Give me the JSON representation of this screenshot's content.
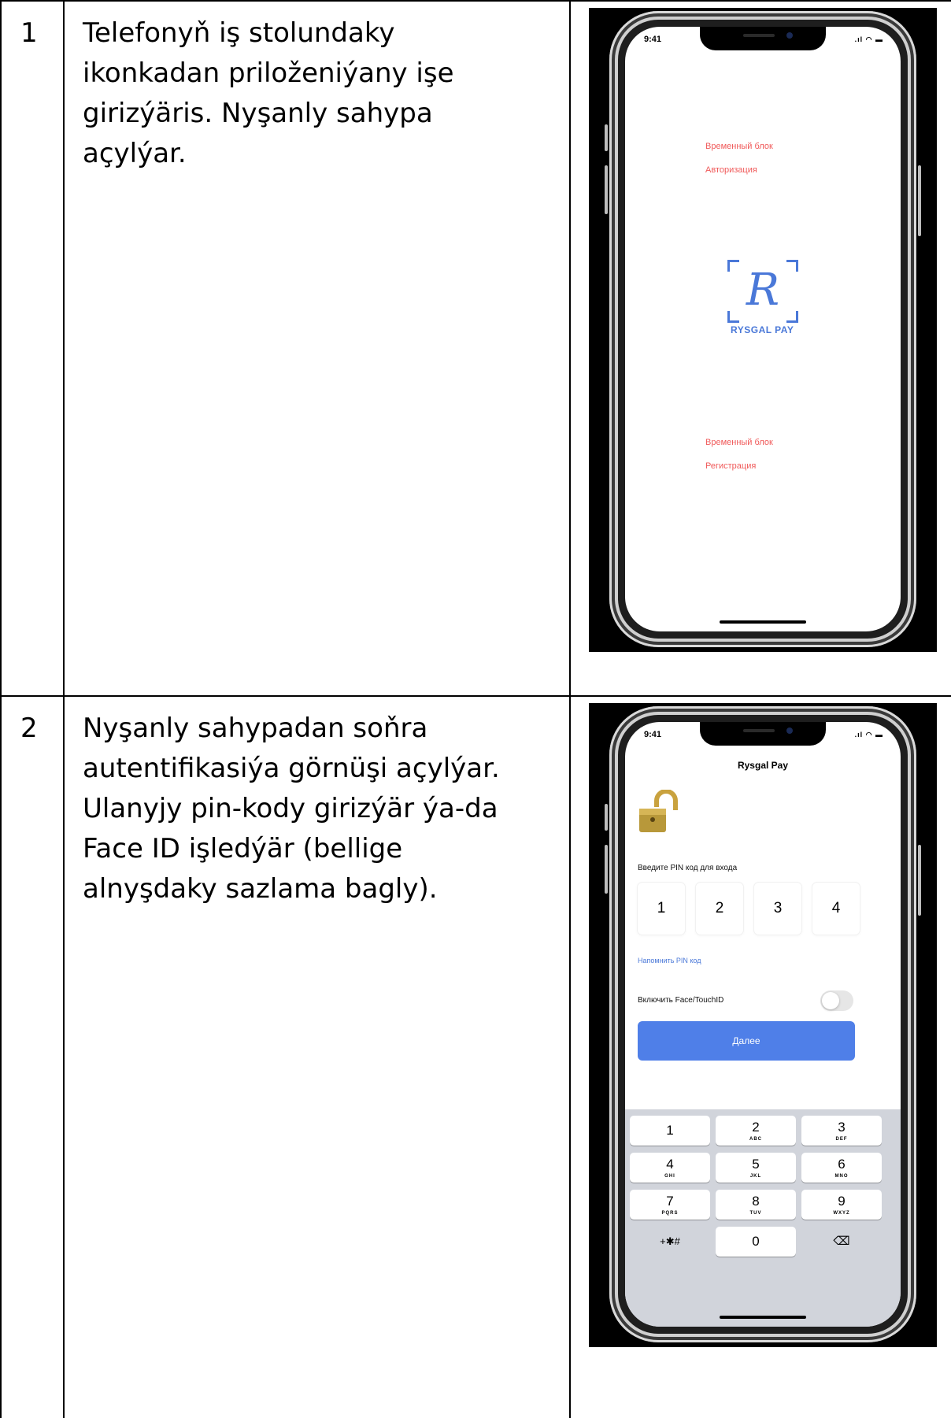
{
  "rows": [
    {
      "number": "1",
      "description": [
        "Telefonyň iş stolundaky",
        "ikonkadan priloženiýany işe",
        "girizýäris. Nyşanly sahypa",
        "açylýar."
      ],
      "screen": {
        "time": "9:41",
        "status_icons": "signal-icon wifi-icon battery-icon",
        "top_temp": "Временный блок",
        "top_action": "Авторизация",
        "logo_monogram": "R",
        "logo_text": "RYSGAL PAY",
        "bottom_temp": "Временный блок",
        "bottom_action": "Регистрация",
        "accent_color": "#f05a5a",
        "brand_color": "#4a78d8"
      }
    },
    {
      "number": "2",
      "description": [
        "Nyşanly sahypadan soňra",
        "autentifikasiýa görnüşi açylýar.",
        "Ulanyjy pin-kody girizýär ýa-da",
        "Face ID işledýär (bellige",
        "alnyşdaky sazlama bagly)."
      ],
      "screen": {
        "time": "9:41",
        "status_icons": "signal-icon wifi-icon battery-icon",
        "title": "Rysgal Pay",
        "pin_label": "Введите PIN код для входа",
        "pin_digits": [
          "1",
          "2",
          "3",
          "4"
        ],
        "remind_link": "Напомнить PIN код",
        "toggle_label": "Включить Face/TouchID",
        "toggle_on": false,
        "next_label": "Далее",
        "button_color": "#4f7fe8",
        "keypad": [
          {
            "digit": "1",
            "letters": ""
          },
          {
            "digit": "2",
            "letters": "ABC"
          },
          {
            "digit": "3",
            "letters": "DEF"
          },
          {
            "digit": "4",
            "letters": "GHI"
          },
          {
            "digit": "5",
            "letters": "JKL"
          },
          {
            "digit": "6",
            "letters": "MNO"
          },
          {
            "digit": "7",
            "letters": "PQRS"
          },
          {
            "digit": "8",
            "letters": "TUV"
          },
          {
            "digit": "9",
            "letters": "WXYZ"
          },
          {
            "digit": "+✱#",
            "letters": ""
          },
          {
            "digit": "0",
            "letters": ""
          },
          {
            "digit": "⌫",
            "letters": ""
          }
        ]
      }
    }
  ]
}
